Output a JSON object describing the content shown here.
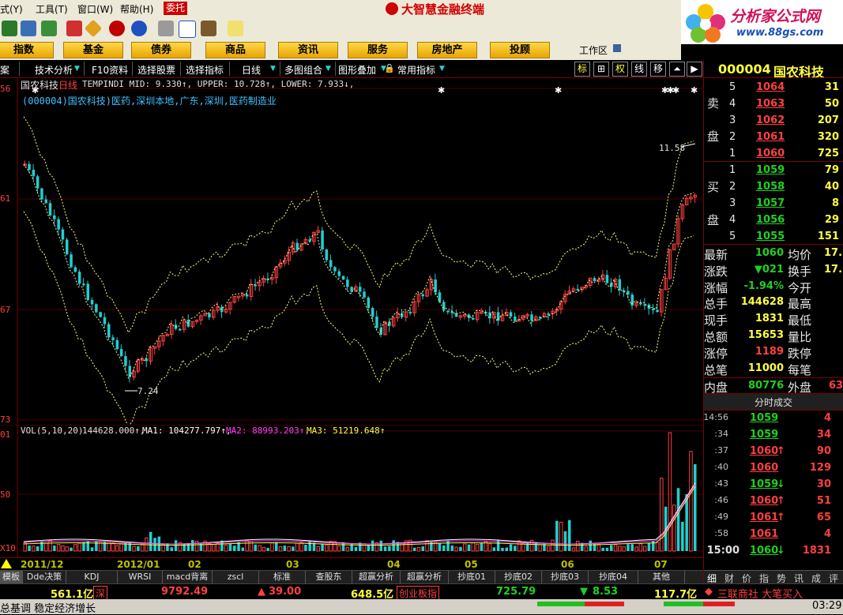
{
  "menu": {
    "items": [
      "式(Y)",
      "工具(T)",
      "窗口(W)",
      "帮助(H)"
    ],
    "trade_label": "委托"
  },
  "app": {
    "title": "大智慧金融终端"
  },
  "logo": {
    "text1": "分析家公式网",
    "text2": "www.88gs.com"
  },
  "categories": [
    "指数",
    "基金",
    "债券",
    "商品",
    "资讯",
    "服务",
    "房地产",
    "投顾"
  ],
  "workspace_label": "工作区",
  "chart_menu": {
    "items": [
      "案",
      "技术分析",
      "F10资料",
      "选择股票",
      "选择指标",
      "日线",
      "多图组合",
      "图形叠加",
      "常用指标"
    ],
    "buttons": [
      "标",
      "⊞",
      "权",
      "线",
      "移",
      "⏶",
      "▶"
    ]
  },
  "main_chart": {
    "header_name": "国农科技",
    "header_period": "日线",
    "header_indicator": "TEMPINDI  MID: 9.330↑, UPPER: 10.728↑, LOWER: 7.933↓,",
    "info_line": "(000004)国农科技)医药,深圳本地,广东,深圳,医药制造业",
    "left_labels": [
      "56",
      "61",
      "67",
      "73"
    ],
    "high_mark": "11.58",
    "low_mark": "7.24"
  },
  "vol_chart": {
    "header": "VOL(5,10,20)",
    "vol": "144628.000↑,",
    "ma1": "MA1: 104277.797↑,",
    "ma2": "MA2: 88993.203↑,",
    "ma3": "MA3: 51219.648↑",
    "left_labels": [
      "01",
      "50",
      "X10"
    ]
  },
  "date_axis": [
    "2011/12",
    "2012/01",
    "02",
    "03",
    "04",
    "05",
    "06",
    "07"
  ],
  "bottom_tabs": [
    "模板",
    "Dde决策",
    "KDJ",
    "WRSI",
    "macd背离",
    "zscl",
    "标准",
    "查股东",
    "超赢分析",
    "超赢分析",
    "抄底01",
    "抄底02",
    "抄底03",
    "抄底04",
    "其他"
  ],
  "status": {
    "sh_amount": "561.1亿",
    "sz_label": "深",
    "sz_index": "9792.49",
    "sz_change": "39.00",
    "cyb_amount": "648.5亿",
    "cyb_label": "创业板指",
    "cyb_index": "725.79",
    "cyb_change": "8.53",
    "cyb_amount2": "117.7亿",
    "news": "三联商社 大笔买入"
  },
  "ticker": {
    "text": "总基调 稳定经济增长",
    "time": "03:29"
  },
  "quote": {
    "code": "000004",
    "name": "国农科技",
    "sell_label": [
      "卖",
      "盘"
    ],
    "buy_label": [
      "买",
      "盘"
    ],
    "sell": [
      {
        "lvl": "5",
        "price": "1064",
        "vol": "31"
      },
      {
        "lvl": "4",
        "price": "1063",
        "vol": "50"
      },
      {
        "lvl": "3",
        "price": "1062",
        "vol": "207"
      },
      {
        "lvl": "2",
        "price": "1061",
        "vol": "320"
      },
      {
        "lvl": "1",
        "price": "1060",
        "vol": "725"
      }
    ],
    "buy": [
      {
        "lvl": "1",
        "price": "1059",
        "vol": "79"
      },
      {
        "lvl": "2",
        "price": "1058",
        "vol": "40"
      },
      {
        "lvl": "3",
        "price": "1057",
        "vol": "8"
      },
      {
        "lvl": "4",
        "price": "1056",
        "vol": "29"
      },
      {
        "lvl": "5",
        "price": "1055",
        "vol": "151"
      }
    ],
    "stats": [
      {
        "k1": "最新",
        "v1": "1060",
        "k2": "均价",
        "v2": "17."
      },
      {
        "k1": "涨跌",
        "v1": "▼021",
        "k2": "换手",
        "v2": "17."
      },
      {
        "k1": "涨幅",
        "v1": "-1.94%",
        "k2": "今开",
        "v2": ""
      },
      {
        "k1": "总手",
        "v1": "144628",
        "k2": "最高",
        "v2": ""
      },
      {
        "k1": "现手",
        "v1": "1831",
        "k2": "最低",
        "v2": ""
      },
      {
        "k1": "总额",
        "v1": "15653",
        "k2": "量比",
        "v2": ""
      },
      {
        "k1": "涨停",
        "v1": "1189",
        "k2": "跌停",
        "v2": ""
      },
      {
        "k1": "总笔",
        "v1": "11000",
        "k2": "每笔",
        "v2": ""
      }
    ],
    "inner_label": "内盘",
    "inner_value": "80776",
    "outer_label": "外盘",
    "outer_value": "63",
    "trades_title": "分时成交",
    "trades": [
      {
        "time": "14:56",
        "price": "1059",
        "arrow": "",
        "vol": "4"
      },
      {
        "time": ":34",
        "price": "1059",
        "arrow": "",
        "vol": "34"
      },
      {
        "time": ":37",
        "price": "1060",
        "arrow": "↑",
        "vol": "90"
      },
      {
        "time": ":40",
        "price": "1060",
        "arrow": "",
        "vol": "129"
      },
      {
        "time": ":43",
        "price": "1059",
        "arrow": "↓",
        "vol": "30"
      },
      {
        "time": ":46",
        "price": "1060",
        "arrow": "↑",
        "vol": "51"
      },
      {
        "time": ":49",
        "price": "1061",
        "arrow": "↑",
        "vol": "65"
      },
      {
        "time": ":58",
        "price": "1061",
        "arrow": "",
        "vol": "4"
      },
      {
        "time": "15:00",
        "price": "1060",
        "arrow": "↓",
        "vol": "1831"
      }
    ],
    "bottom_tabs": [
      "细",
      "财",
      "价",
      "指",
      "势",
      "讯",
      "成",
      "评"
    ]
  },
  "colors": {
    "up": "#ff4040",
    "down": "#20d0d0",
    "band": "#ffff80",
    "ma1": "#ffffff",
    "ma2": "#ff40ff",
    "ma3": "#ffff40"
  }
}
